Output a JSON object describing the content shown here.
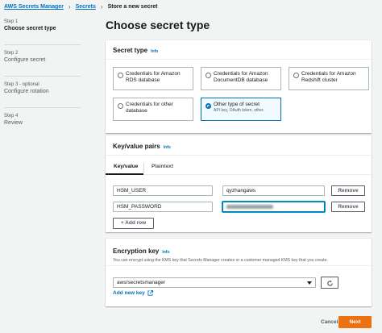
{
  "breadcrumb": {
    "items": [
      {
        "label": "AWS Secrets Manager"
      },
      {
        "label": "Secrets"
      },
      {
        "label": "Store a new secret"
      }
    ]
  },
  "steps": [
    {
      "step": "Step 1",
      "name": "Choose secret type"
    },
    {
      "step": "Step 2",
      "name": "Configure secret"
    },
    {
      "step": "Step 3 - optional",
      "name": "Configure rotation"
    },
    {
      "step": "Step 4",
      "name": "Review"
    }
  ],
  "page_title": "Choose secret type",
  "secret_type": {
    "header": "Secret type",
    "info": "Info",
    "options": [
      {
        "title": "Credentials for Amazon RDS database",
        "desc": ""
      },
      {
        "title": "Credentials for Amazon DocumentDB database",
        "desc": ""
      },
      {
        "title": "Credentials for Amazon Redshift cluster",
        "desc": ""
      },
      {
        "title": "Credentials for other database",
        "desc": ""
      },
      {
        "title": "Other type of secret",
        "desc": "API key, OAuth token, other."
      }
    ],
    "selected": 4
  },
  "kv": {
    "header": "Key/value pairs",
    "info": "Info",
    "tabs": [
      {
        "label": "Key/value"
      },
      {
        "label": "Plaintext"
      }
    ],
    "rows": [
      {
        "key": "HSM_USER",
        "value": "qyzhangaws",
        "remove": "Remove"
      },
      {
        "key": "HSM_PASSWORD",
        "value": "",
        "remove": "Remove"
      }
    ],
    "add_row": "+ Add row"
  },
  "encryption": {
    "header": "Encryption key",
    "info": "Info",
    "description": "You can encrypt using the KMS key that Secrets Manager creates or a customer managed KMS key that you create.",
    "selected_key": "aws/secretsmanager",
    "add_new_key": "Add new key"
  },
  "footer": {
    "cancel": "Cancel",
    "next": "Next"
  },
  "colors": {
    "link": "#0073bb",
    "primary": "#ec7211",
    "selected_bg": "#f1faff"
  }
}
